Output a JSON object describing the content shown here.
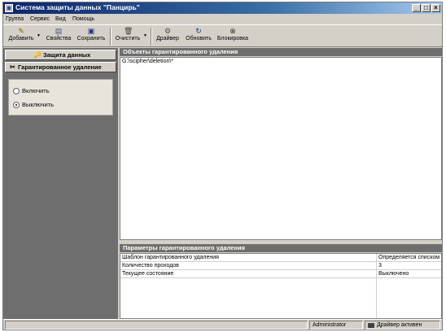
{
  "window": {
    "title": "Система защиты данных \"Панцирь\"",
    "controls": [
      "_",
      "□",
      "×"
    ]
  },
  "menu": [
    "Группа",
    "Сервис",
    "Вид",
    "Помощь"
  ],
  "toolbar": {
    "add": "Добавить",
    "properties": "Свойства",
    "save": "Сохранить",
    "clear": "Очистить",
    "driver": "Драйвер",
    "refresh": "Обновить",
    "lock": "Блокировка"
  },
  "sidebar": {
    "data_protection": "Защита данных",
    "guaranteed_deletion": "Гарантированное удаление",
    "radio_on": "Включить",
    "radio_off": "Выключить",
    "selected": "Выключить"
  },
  "objects": {
    "header": "Объекты гарантированного удаления",
    "items": [
      "G:\\scipher\\deletion\\*"
    ]
  },
  "params": {
    "header": "Параметры гарантированного удаления",
    "rows": [
      {
        "key": "Шаблон гарантированного удаления",
        "value": "Определяется списком"
      },
      {
        "key": "Количество проходов",
        "value": "3"
      },
      {
        "key": "Текущее состояние",
        "value": "Выключено"
      }
    ]
  },
  "status": {
    "user": "Administrator",
    "driver": "Драйвер активен"
  },
  "colors": {
    "title_bar": "#0a246a",
    "panel_header": "#6e6e6e",
    "face": "#d4d0c8"
  }
}
